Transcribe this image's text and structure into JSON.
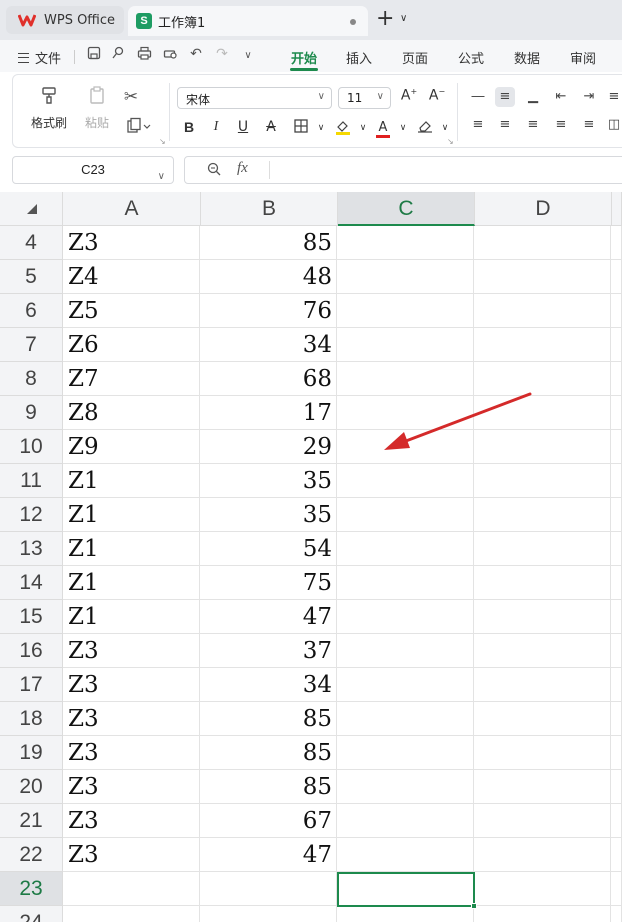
{
  "tabs": {
    "home_label": "WPS Office",
    "doc_label": "工作簿1"
  },
  "menu": {
    "file_label": "文件",
    "tabs": [
      "开始",
      "插入",
      "页面",
      "公式",
      "数据",
      "审阅"
    ]
  },
  "ribbon": {
    "format_painter_label": "格式刷",
    "paste_label": "粘贴",
    "font_name": "宋体",
    "font_size": "11"
  },
  "namebox": {
    "value": "C23"
  },
  "formula": {
    "fx_label": "fx",
    "value": ""
  },
  "sheet": {
    "columns": [
      "A",
      "B",
      "C",
      "D"
    ],
    "active_column": "C",
    "active_cell": "C23",
    "rows": [
      {
        "num": "4",
        "a": "Z3",
        "b": "85"
      },
      {
        "num": "5",
        "a": "Z4",
        "b": "48"
      },
      {
        "num": "6",
        "a": "Z5",
        "b": "76"
      },
      {
        "num": "7",
        "a": "Z6",
        "b": "34"
      },
      {
        "num": "8",
        "a": "Z7",
        "b": "68"
      },
      {
        "num": "9",
        "a": "Z8",
        "b": "17"
      },
      {
        "num": "10",
        "a": "Z9",
        "b": "29"
      },
      {
        "num": "11",
        "a": "Z1",
        "b": "35"
      },
      {
        "num": "12",
        "a": "Z1",
        "b": "35"
      },
      {
        "num": "13",
        "a": "Z1",
        "b": "54"
      },
      {
        "num": "14",
        "a": "Z1",
        "b": "75"
      },
      {
        "num": "15",
        "a": "Z1",
        "b": "47"
      },
      {
        "num": "16",
        "a": "Z3",
        "b": "37"
      },
      {
        "num": "17",
        "a": "Z3",
        "b": "34"
      },
      {
        "num": "18",
        "a": "Z3",
        "b": "85"
      },
      {
        "num": "19",
        "a": "Z3",
        "b": "85"
      },
      {
        "num": "20",
        "a": "Z3",
        "b": "85"
      },
      {
        "num": "21",
        "a": "Z3",
        "b": "67"
      },
      {
        "num": "22",
        "a": "Z3",
        "b": "47"
      },
      {
        "num": "23",
        "a": "",
        "b": ""
      },
      {
        "num": "24",
        "a": "",
        "b": ""
      }
    ]
  },
  "colors": {
    "accent": "#1d8a4d",
    "annotation_arrow": "#d42a2a"
  }
}
